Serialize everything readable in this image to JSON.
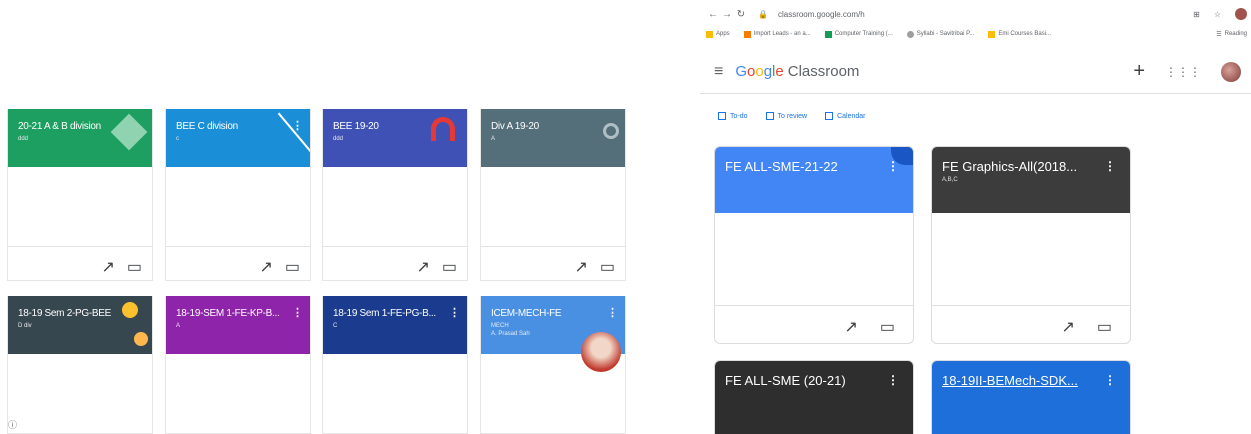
{
  "left": {
    "cards": [
      {
        "title": "20-21 A & B division",
        "sub": "ddd",
        "color": "#1e9f62"
      },
      {
        "title": "BEE C division",
        "sub": "c",
        "color": "#1a8fd8"
      },
      {
        "title": "BEE 19-20",
        "sub": "ddd",
        "color": "#3f51b5"
      },
      {
        "title": "Div A 19-20",
        "sub": "A",
        "color": "#546e7a"
      },
      {
        "title": "18-19 Sem 2-PG-BEE",
        "sub": "D div",
        "color": "#37474f"
      },
      {
        "title": "18-19-SEM 1-FE-KP-B...",
        "sub": "A",
        "color": "#8e24aa"
      },
      {
        "title": "18-19 Sem 1-FE-PG-B...",
        "sub": "C",
        "color": "#1a3b8e"
      },
      {
        "title": "ICEM-MECH-FE",
        "sub": "MECH",
        "sub2": "A. Prasad Sah",
        "color": "#4a90e2"
      }
    ],
    "help_icon": "help-icon"
  },
  "browser": {
    "url": "classroom.google.com/h",
    "bookmarks": [
      {
        "label": "Apps",
        "color": "#fbbc05"
      },
      {
        "label": "Import Leads - an a...",
        "color": "#f57c00"
      },
      {
        "label": "Computer Training (...",
        "color": "#0f9d58"
      },
      {
        "label": "Syllabi - Savitribai P...",
        "color": "#9e9e9e"
      },
      {
        "label": "Emi Courses Basi...",
        "color": "#fbbc05"
      },
      {
        "label": "Reading",
        "color": "#5f6368"
      }
    ],
    "brand": {
      "g1": "G",
      "g2": "o",
      "g3": "o",
      "g4": "g",
      "g5": "l",
      "g6": "e",
      "product": "Classroom"
    },
    "plus": "+",
    "links": [
      "To-do",
      "To review",
      "Calendar"
    ],
    "cards": [
      {
        "title": "FE ALL-SME-21-22",
        "sub": "",
        "color": "#4285f4"
      },
      {
        "title": "FE Graphics-All(2018...",
        "sub": "A,B,C",
        "color": "#3c3c3c"
      },
      {
        "title": "FE ALL-SME (20-21)",
        "sub": "",
        "color": "#2e2e2e"
      },
      {
        "title": "18-19II-BEMech-SDK...",
        "sub": "",
        "color": "#1e6fd9"
      }
    ]
  }
}
